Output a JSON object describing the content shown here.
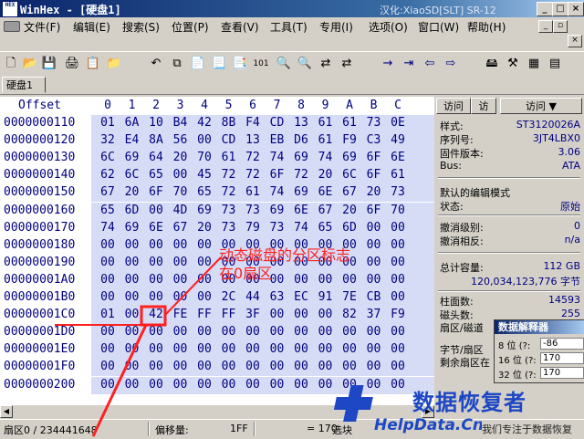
{
  "window": {
    "title": "WinHex - [硬盘1]",
    "title_right": "汉化:XiaoSD[SLT] SR-12",
    "app_icon": "HEX",
    "buttons": {
      "minimize": "_",
      "maximize": "□",
      "close": "×"
    }
  },
  "menu": {
    "items": [
      "文件(F)",
      "编辑(E)",
      "搜索(S)",
      "位置(P)",
      "查看(V)",
      "工具(T)",
      "专用(I)",
      "选项(O)",
      "窗口(W)",
      "帮助(H)"
    ],
    "mdi_buttons": {
      "minimize": "_",
      "restore": "▫",
      "close": "×"
    }
  },
  "toolbar": {
    "icons": [
      "new-icon",
      "open-icon",
      "save-icon",
      "print-icon",
      "properties-icon",
      "open-folder-icon",
      "undo-icon",
      "copy-icon",
      "paste-icon",
      "paste-special-icon",
      "clipboard-icon",
      "convert-binary-icon",
      "find-icon",
      "find-hex-icon",
      "replace-icon",
      "replace-hex-icon",
      "goto-icon",
      "goto-offset-icon",
      "back-icon",
      "forward-icon",
      "disk-icon",
      "tools-icon",
      "ram-icon",
      "more-icon"
    ],
    "glyphs": [
      "🗋",
      "📂",
      "💾",
      "🖨",
      "📋",
      "📁",
      "↶",
      "⧉",
      "📄",
      "📃",
      "📑",
      "101",
      "🔍",
      "🔍",
      "⇄",
      "⇄",
      "→",
      "⇥",
      "⇦",
      "⇨",
      "🖴",
      "⚒",
      "▦",
      "▤"
    ]
  },
  "tab": {
    "label": "硬盘1"
  },
  "hex": {
    "offset_header": "Offset",
    "columns": [
      "0",
      "1",
      "2",
      "3",
      "4",
      "5",
      "6",
      "7",
      "8",
      "9",
      "A",
      "B",
      "C"
    ],
    "rows": [
      {
        "offset": "0000000110",
        "bytes": [
          "01",
          "6A",
          "10",
          "B4",
          "42",
          "8B",
          "F4",
          "CD",
          "13",
          "61",
          "61",
          "73",
          "0E"
        ]
      },
      {
        "offset": "0000000120",
        "bytes": [
          "32",
          "E4",
          "8A",
          "56",
          "00",
          "CD",
          "13",
          "EB",
          "D6",
          "61",
          "F9",
          "C3",
          "49"
        ]
      },
      {
        "offset": "0000000130",
        "bytes": [
          "6C",
          "69",
          "64",
          "20",
          "70",
          "61",
          "72",
          "74",
          "69",
          "74",
          "69",
          "6F",
          "6E"
        ]
      },
      {
        "offset": "0000000140",
        "bytes": [
          "62",
          "6C",
          "65",
          "00",
          "45",
          "72",
          "72",
          "6F",
          "72",
          "20",
          "6C",
          "6F",
          "61"
        ]
      },
      {
        "offset": "0000000150",
        "bytes": [
          "67",
          "20",
          "6F",
          "70",
          "65",
          "72",
          "61",
          "74",
          "69",
          "6E",
          "67",
          "20",
          "73"
        ]
      },
      {
        "offset": "0000000160",
        "bytes": [
          "65",
          "6D",
          "00",
          "4D",
          "69",
          "73",
          "73",
          "69",
          "6E",
          "67",
          "20",
          "6F",
          "70"
        ]
      },
      {
        "offset": "0000000170",
        "bytes": [
          "74",
          "69",
          "6E",
          "67",
          "20",
          "73",
          "79",
          "73",
          "74",
          "65",
          "6D",
          "00",
          "00"
        ]
      },
      {
        "offset": "0000000180",
        "bytes": [
          "00",
          "00",
          "00",
          "00",
          "00",
          "00",
          "00",
          "00",
          "00",
          "00",
          "00",
          "00",
          "00"
        ]
      },
      {
        "offset": "0000000190",
        "bytes": [
          "00",
          "00",
          "00",
          "00",
          "00",
          "00",
          "00",
          "00",
          "00",
          "00",
          "00",
          "00",
          "00"
        ]
      },
      {
        "offset": "00000001A0",
        "bytes": [
          "00",
          "00",
          "00",
          "00",
          "00",
          "00",
          "00",
          "00",
          "00",
          "00",
          "00",
          "00",
          "00"
        ]
      },
      {
        "offset": "00000001B0",
        "bytes": [
          "00",
          "00",
          "00",
          "00",
          "00",
          "2C",
          "44",
          "63",
          "EC",
          "91",
          "7E",
          "CB",
          "00"
        ]
      },
      {
        "offset": "00000001C0",
        "bytes": [
          "01",
          "00",
          "42",
          "FE",
          "FF",
          "FF",
          "3F",
          "00",
          "00",
          "00",
          "82",
          "37",
          "F9"
        ]
      },
      {
        "offset": "00000001D0",
        "bytes": [
          "00",
          "00",
          "00",
          "00",
          "00",
          "00",
          "00",
          "00",
          "00",
          "00",
          "00",
          "00",
          "00"
        ]
      },
      {
        "offset": "00000001E0",
        "bytes": [
          "00",
          "00",
          "00",
          "00",
          "00",
          "00",
          "00",
          "00",
          "00",
          "00",
          "00",
          "00",
          "00"
        ]
      },
      {
        "offset": "00000001F0",
        "bytes": [
          "00",
          "00",
          "00",
          "00",
          "00",
          "00",
          "00",
          "00",
          "00",
          "00",
          "00",
          "00",
          "00"
        ]
      },
      {
        "offset": "0000000200",
        "bytes": [
          "00",
          "00",
          "00",
          "00",
          "00",
          "00",
          "00",
          "00",
          "00",
          "00",
          "00",
          "00",
          "00"
        ]
      }
    ],
    "highlight": {
      "row": 11,
      "col": 2
    },
    "scroll": {
      "left": "◀",
      "right": "▶"
    }
  },
  "annotation": {
    "line1": "动态磁盘的分区标志",
    "line2": "在0扇区",
    "color": "#ff2020"
  },
  "side": {
    "tabs": [
      "访问",
      "访",
      "访问 ▼"
    ],
    "info": [
      {
        "label": "样式:",
        "value": "ST3120026A"
      },
      {
        "label": "序列号:",
        "value": "3JT4LBX0"
      },
      {
        "label": "固件版本:",
        "value": "3.06"
      },
      {
        "label": "Bus:",
        "value": "ATA"
      }
    ],
    "edit_mode_title": "默认的编辑模式",
    "edit": [
      {
        "label": "状态:",
        "value": "原始"
      }
    ],
    "undo": [
      {
        "label": "撤消级别:",
        "value": "0"
      },
      {
        "label": "撤消相反:",
        "value": "n/a"
      }
    ],
    "capacity_label": "总计容量:",
    "capacity_value": "112 GB",
    "capacity_bytes": "120,034,123,776 字节",
    "geometry": [
      {
        "label": "柱面数:",
        "value": "14593"
      },
      {
        "label": "磁头数:",
        "value": "255"
      }
    ],
    "sector_label": "扇区/磁道",
    "bytes_per_sector": "字节/扇区",
    "remaining_sector": "剩余扇区在"
  },
  "data_interpreter": {
    "title": "数据解释器",
    "rows": [
      {
        "label": "8 位 (?:",
        "value": "-86"
      },
      {
        "label": "16 位 (?:",
        "value": "170"
      },
      {
        "label": "32 位 (?:",
        "value": "170"
      }
    ]
  },
  "status": {
    "sector": "扇区0 / 234441648",
    "offset_label": "偏移量:",
    "offset_value": "1FF",
    "selection_value": "= 170",
    "selection_label": "选块"
  },
  "watermark": {
    "cn": "数据恢复者",
    "url": "HelpData.Cn",
    "slogan": "我们专注于数据恢复"
  }
}
